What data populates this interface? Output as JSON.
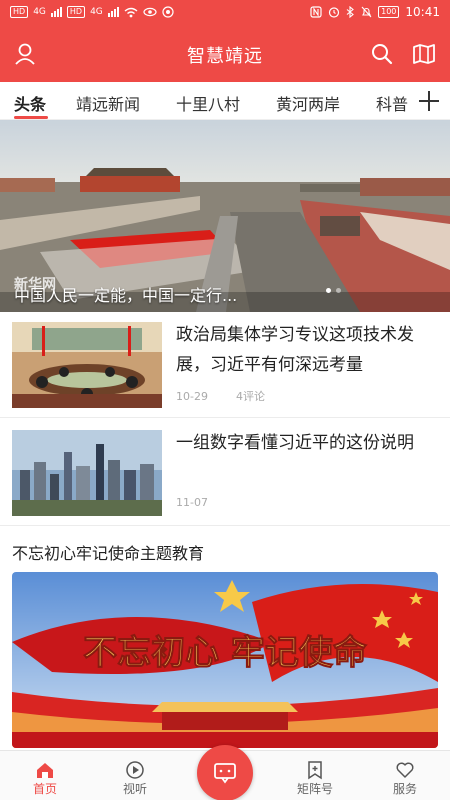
{
  "status_bar": {
    "network_badge_1": "HD",
    "network_badge_2": "HD",
    "signal_label_1": "4G",
    "signal_label_2": "4G",
    "battery": "100",
    "time": "10:41"
  },
  "header": {
    "title": "智慧靖远",
    "icons": [
      "user-icon",
      "search-icon",
      "map-icon"
    ]
  },
  "tabs": [
    "头条",
    "靖远新闻",
    "十里八村",
    "黄河两岸",
    "科普"
  ],
  "active_tab": "头条",
  "hero": {
    "caption": "中国人民一定能，中国一定行...",
    "watermark": "新华网",
    "slide_count": 2,
    "active_slide": 1
  },
  "news": [
    {
      "title": "政治局集体学习专议这项技术发展，习近平有何深远考量",
      "date": "10-29",
      "comments": "4评论"
    },
    {
      "title": "一组数字看懂习近平的这份说明",
      "date": "11-07",
      "comments": ""
    }
  ],
  "section": {
    "title": "不忘初心牢记使命主题教育",
    "banner_text": "不忘初心 牢记使命"
  },
  "bottom_nav": [
    {
      "label": "首页",
      "icon": "home-icon"
    },
    {
      "label": "视听",
      "icon": "play-icon"
    },
    {
      "label": "",
      "icon": "chat-icon"
    },
    {
      "label": "矩阵号",
      "icon": "bookmark-icon"
    },
    {
      "label": "服务",
      "icon": "heart-icon"
    }
  ],
  "colors": {
    "brand": "#ee4a46",
    "flag_red": "#d91e18",
    "gold": "#f7c948"
  }
}
